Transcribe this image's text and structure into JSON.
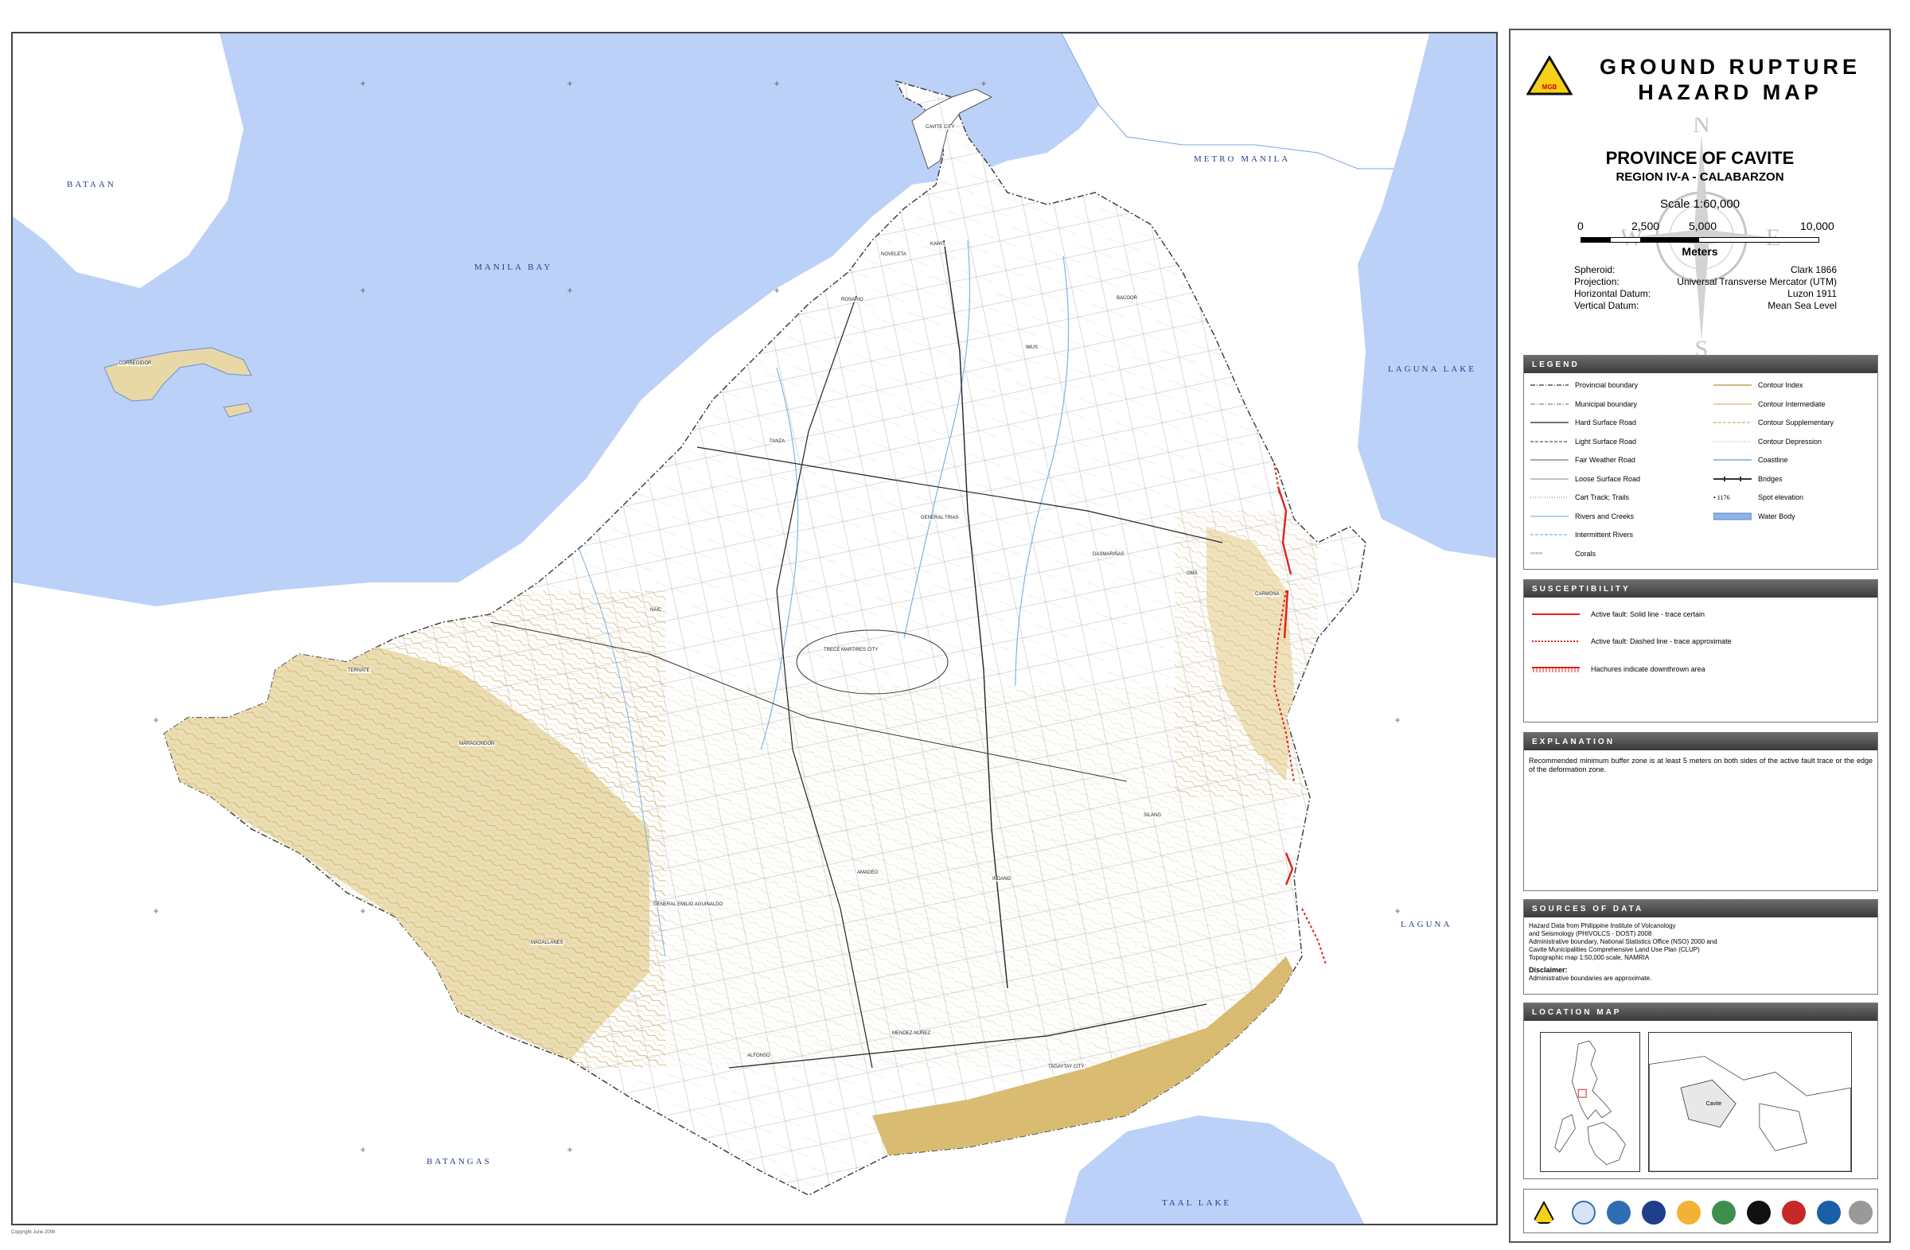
{
  "title": {
    "line1": "GROUND RUPTURE",
    "line2": "HAZARD MAP",
    "badge": "MGB"
  },
  "province": {
    "name": "PROVINCE OF CAVITE",
    "region": "REGION IV-A - CALABARZON",
    "scale": "Scale 1:60,000",
    "scale_ticks": [
      "0",
      "2,500",
      "5,000",
      "10,000"
    ],
    "scale_unit": "Meters"
  },
  "compass": {
    "n": "N",
    "s": "S",
    "e": "E",
    "w": "W"
  },
  "datum": [
    {
      "label": "Spheroid:",
      "value": "Clark 1866"
    },
    {
      "label": "Projection:",
      "value": "Universal Transverse Mercator (UTM)"
    },
    {
      "label": "Horizontal Datum:",
      "value": "Luzon 1911"
    },
    {
      "label": "Vertical Datum:",
      "value": "Mean Sea Level"
    }
  ],
  "legend": {
    "heading": "LEGEND",
    "left": [
      {
        "label": "Provincial boundary",
        "style": "dashdot",
        "color": "#333333"
      },
      {
        "label": "Municipal boundary",
        "style": "dashdot",
        "color": "#888888"
      },
      {
        "label": "Hard Surface Road",
        "style": "solid",
        "color": "#222222"
      },
      {
        "label": "Light Surface Road",
        "style": "dashed",
        "color": "#555555"
      },
      {
        "label": "Fair Weather Road",
        "style": "solid",
        "color": "#777777"
      },
      {
        "label": "Loose Surface Road",
        "style": "solid",
        "color": "#999999"
      },
      {
        "label": "Cart Track; Trails",
        "style": "dotted",
        "color": "#999999"
      },
      {
        "label": "Rivers and Creeks",
        "style": "solid",
        "color": "#7fb2e6"
      },
      {
        "label": "Intermittent Rivers",
        "style": "dashed",
        "color": "#7fb2e6"
      },
      {
        "label": "Corals",
        "style": "corals",
        "color": "#888888"
      }
    ],
    "right": [
      {
        "label": "Contour Index",
        "style": "solid",
        "color": "#b88d3a"
      },
      {
        "label": "Contour Intermediate",
        "style": "solid",
        "color": "#d7b46a"
      },
      {
        "label": "Contour Supplementary",
        "style": "dashed",
        "color": "#d7b46a"
      },
      {
        "label": "Contour Depression",
        "style": "dotted",
        "color": "#d7b46a"
      },
      {
        "label": "Coastline",
        "style": "solid",
        "color": "#5a9bd5"
      },
      {
        "label": "Bridges",
        "style": "bridge",
        "color": "#333333"
      },
      {
        "label": "Spot elevation",
        "style": "spot",
        "color": "#333333",
        "sample": "1176"
      },
      {
        "label": "Water Body",
        "style": "fill",
        "color": "#8db3e8"
      }
    ]
  },
  "susceptibility": {
    "heading": "SUSCEPTIBILITY",
    "items": [
      {
        "label": "Active fault: Solid line - trace certain",
        "style": "solid",
        "color": "#e0201a"
      },
      {
        "label": "Active fault: Dashed line - trace approximate",
        "style": "dotted",
        "color": "#e0201a"
      },
      {
        "label": "Hachures indicate downthrown area",
        "style": "hachure",
        "color": "#e0201a"
      }
    ]
  },
  "explanation": {
    "heading": "EXPLANATION",
    "text": "Recommended minimum buffer zone is at least 5 meters on both sides of the active fault trace or the edge of the deformation zone."
  },
  "sources": {
    "heading": "SOURCES OF DATA",
    "lines": [
      "Hazard Data from Philippine Institute of Volcanology",
      "and Seismology (PHIVOLCS - DOST) 2008",
      "Administrative boundary, National Statistics Office (NSO) 2000 and",
      "Cavite Municipalities Comprehensive Land Use Plan (CLUP)",
      "Topographic map 1:50,000 scale, NAMRIA"
    ],
    "disclaimer_title": "Disclaimer:",
    "disclaimer": "Administrative boundaries are approximate."
  },
  "location_map": {
    "heading": "LOCATION MAP",
    "inset_label": "Cavite"
  },
  "map": {
    "water_labels": [
      "BATAAN",
      "MANILA BAY",
      "METRO MANILA",
      "LAGUNA LAKE",
      "LAGUNA",
      "BATANGAS",
      "TAAL LAKE"
    ],
    "towns": [
      "CAVITE CITY",
      "NOVELETA",
      "KAWIT",
      "ROSARIO",
      "BACOOR",
      "IMUS",
      "TANZA",
      "GENERAL TRIAS",
      "DASMARIÑAS",
      "GMA",
      "CARMONA",
      "NAIC",
      "TRECE MARTIRES CITY",
      "TERNATE",
      "MARAGONDON",
      "SILANG",
      "AMADEO",
      "INDANG",
      "GENERAL EMILIO AGUINALDO",
      "MAGALLANES",
      "MENDEZ-NUÑEZ",
      "ALFONSO",
      "TAGAYTAY CITY",
      "CORREGIDOR"
    ],
    "copyright": "Copyright June 2008",
    "colors": {
      "sea": "#bcd1f7",
      "land": "#ffffff",
      "upland": "#e8d8a6",
      "fault": "#e0201a"
    }
  }
}
